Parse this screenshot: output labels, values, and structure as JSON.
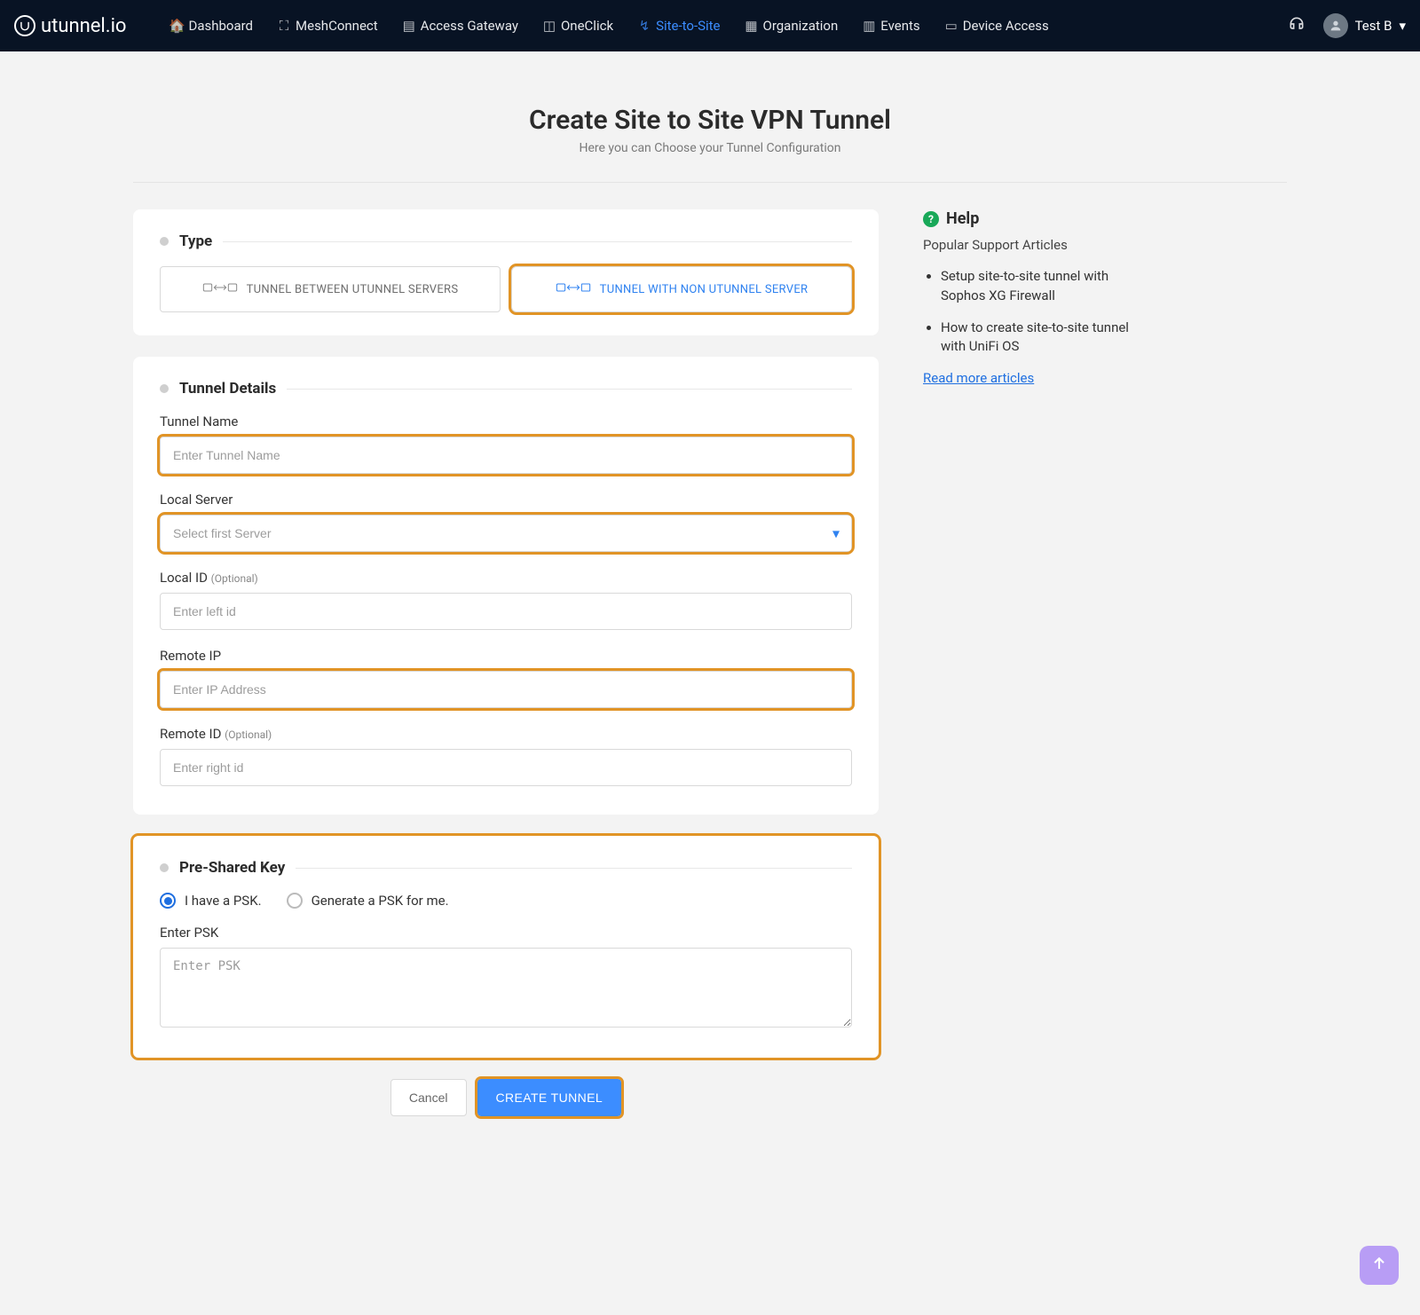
{
  "brand": "utunnel.io",
  "nav": {
    "items": [
      {
        "label": "Dashboard",
        "active": false
      },
      {
        "label": "MeshConnect",
        "active": false
      },
      {
        "label": "Access Gateway",
        "active": false
      },
      {
        "label": "OneClick",
        "active": false
      },
      {
        "label": "Site-to-Site",
        "active": true
      },
      {
        "label": "Organization",
        "active": false
      },
      {
        "label": "Events",
        "active": false
      },
      {
        "label": "Device Access",
        "active": false
      }
    ],
    "user": "Test B"
  },
  "header": {
    "title": "Create Site to Site VPN Tunnel",
    "subtitle": "Here you can Choose your Tunnel Configuration"
  },
  "type": {
    "section": "Type",
    "option1": "TUNNEL BETWEEN UTUNNEL SERVERS",
    "option2": "TUNNEL WITH NON UTUNNEL SERVER"
  },
  "details": {
    "section": "Tunnel Details",
    "tunnel_name_label": "Tunnel Name",
    "tunnel_name_placeholder": "Enter Tunnel Name",
    "local_server_label": "Local Server",
    "local_server_placeholder": "Select first Server",
    "local_id_label": "Local ID",
    "optional": "(Optional)",
    "local_id_placeholder": "Enter left id",
    "remote_ip_label": "Remote IP",
    "remote_ip_placeholder": "Enter IP Address",
    "remote_id_label": "Remote ID",
    "remote_id_placeholder": "Enter right id"
  },
  "psk": {
    "section": "Pre-Shared Key",
    "have": "I have a PSK.",
    "generate": "Generate a PSK for me.",
    "enter_label": "Enter PSK",
    "enter_placeholder": "Enter PSK"
  },
  "actions": {
    "cancel": "Cancel",
    "create": "CREATE TUNNEL"
  },
  "help": {
    "title": "Help",
    "subtitle": "Popular Support Articles",
    "articles": [
      "Setup site-to-site tunnel with Sophos XG Firewall",
      "How to create site-to-site tunnel with UniFi OS"
    ],
    "more": "Read more articles"
  },
  "colors": {
    "accent_blue": "#3c8dff",
    "highlight_orange": "#e19426",
    "nav_bg": "#081324"
  }
}
